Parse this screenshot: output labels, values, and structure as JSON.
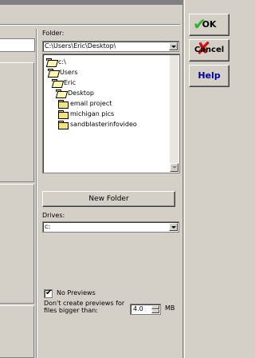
{
  "folder": {
    "label": "Folder:",
    "path": "C:\\Users\\Eric\\Desktop\\",
    "tree": [
      {
        "label": "c:\\",
        "state": "open"
      },
      {
        "label": "Users",
        "state": "open"
      },
      {
        "label": "Eric",
        "state": "open"
      },
      {
        "label": "Desktop",
        "state": "open"
      },
      {
        "label": "email project",
        "state": "closed"
      },
      {
        "label": "michigan pics",
        "state": "closed"
      },
      {
        "label": "sandblasterinfovideo",
        "state": "closed"
      }
    ]
  },
  "new_folder_label": "New Folder",
  "drives": {
    "label": "Drives:",
    "value": "c:"
  },
  "previews": {
    "checkbox_label": "No Previews",
    "checked": true,
    "limit_text": "Don't create previews for files bigger than:",
    "size_value": "4.0",
    "unit": "MB"
  },
  "buttons": {
    "ok": "OK",
    "cancel": "Cancel",
    "help": "Help"
  }
}
